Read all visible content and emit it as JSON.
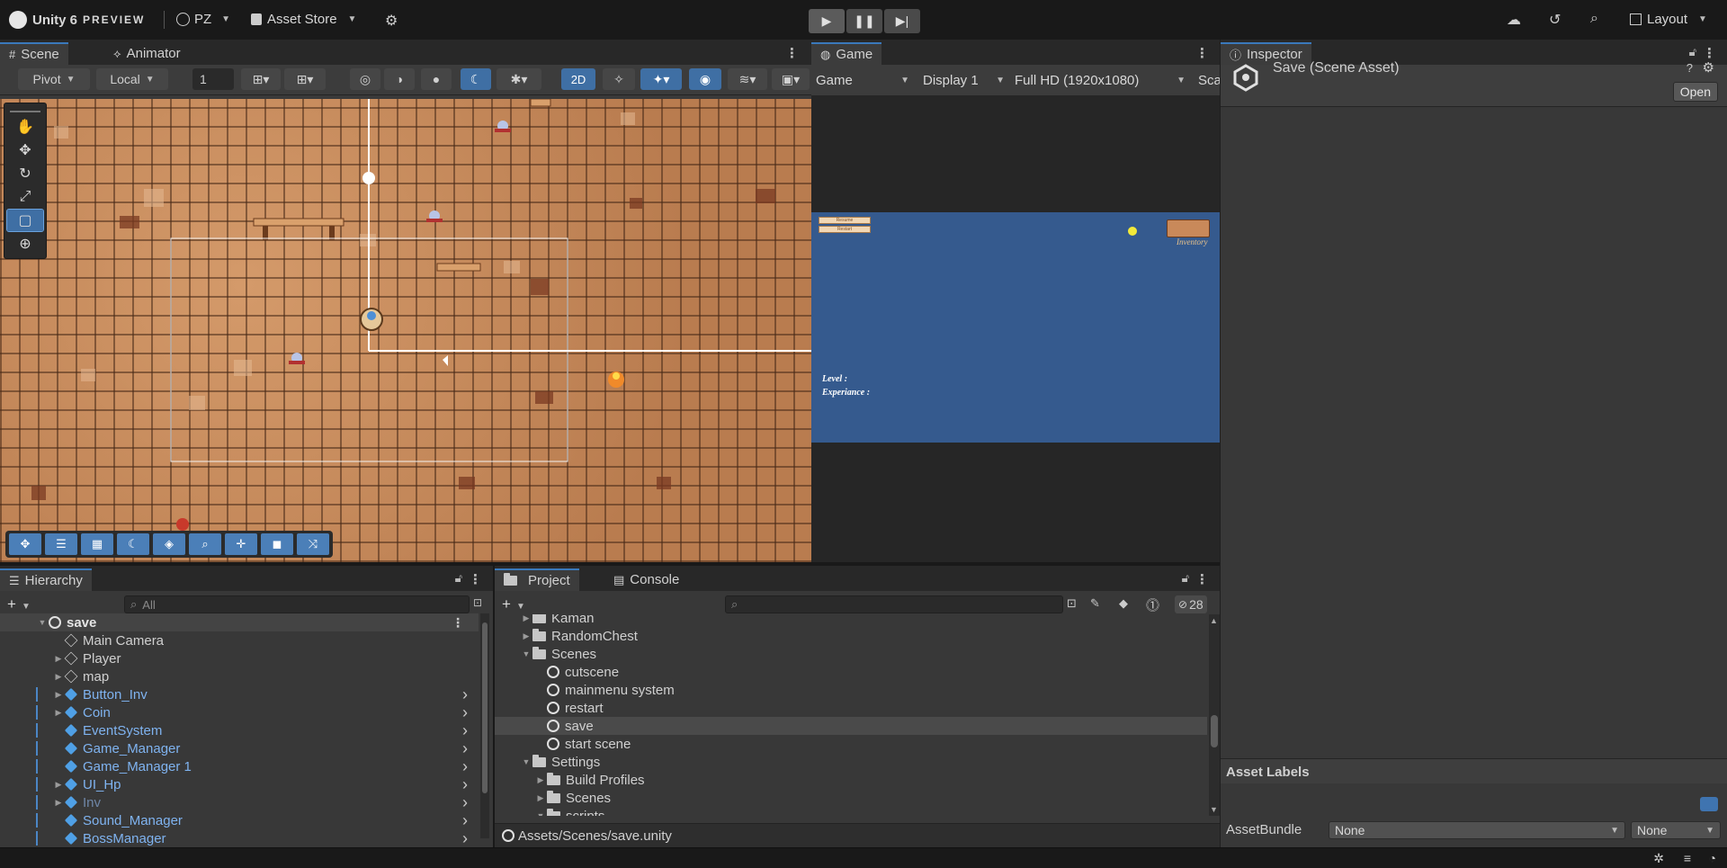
{
  "topbar": {
    "app_name": "Unity 6",
    "edition": "PREVIEW",
    "account": "PZ",
    "asset_store": "Asset Store",
    "layout": "Layout"
  },
  "scene": {
    "tabs": [
      "Scene",
      "Animator"
    ],
    "pivot": "Pivot",
    "local": "Local",
    "grid_snap_value": "1",
    "mode_2d": "2D"
  },
  "game": {
    "tab": "Game",
    "mode": "Game",
    "display": "Display 1",
    "resolution": "Full HD (1920x1080)",
    "scale_truncated": "Sca",
    "hud_button_1": "Resume",
    "hud_button_2": "Restart",
    "inventory_label": "Inventory",
    "level_label": "Level :",
    "experience_label": "Experiance :"
  },
  "inspector": {
    "tab": "Inspector",
    "asset_title": "Save (Scene Asset)",
    "open_button": "Open",
    "asset_labels": "Asset Labels",
    "asset_bundle_label": "AssetBundle",
    "asset_bundle_value": "None",
    "asset_variant_value": "None"
  },
  "hierarchy": {
    "tab": "Hierarchy",
    "search_placeholder": "All",
    "scene_name": "save",
    "items": [
      {
        "label": "Main Camera",
        "prefab": false,
        "expandable": false,
        "has_arrow": false,
        "dim": false
      },
      {
        "label": "Player",
        "prefab": false,
        "expandable": true,
        "has_arrow": false,
        "dim": false
      },
      {
        "label": "map",
        "prefab": false,
        "expandable": true,
        "has_arrow": false,
        "dim": false
      },
      {
        "label": "Button_Inv",
        "prefab": true,
        "expandable": true,
        "has_arrow": true,
        "dim": false
      },
      {
        "label": "Coin",
        "prefab": true,
        "expandable": true,
        "has_arrow": true,
        "dim": false
      },
      {
        "label": "EventSystem",
        "prefab": true,
        "expandable": false,
        "has_arrow": true,
        "dim": false
      },
      {
        "label": "Game_Manager",
        "prefab": true,
        "expandable": false,
        "has_arrow": true,
        "dim": false
      },
      {
        "label": "Game_Manager 1",
        "prefab": true,
        "expandable": false,
        "has_arrow": true,
        "dim": false
      },
      {
        "label": "UI_Hp",
        "prefab": true,
        "expandable": true,
        "has_arrow": true,
        "dim": false
      },
      {
        "label": "Inv",
        "prefab": true,
        "expandable": true,
        "has_arrow": true,
        "dim": true
      },
      {
        "label": "Sound_Manager",
        "prefab": true,
        "expandable": false,
        "has_arrow": true,
        "dim": false
      },
      {
        "label": "BossManager",
        "prefab": true,
        "expandable": false,
        "has_arrow": true,
        "dim": false
      }
    ]
  },
  "project": {
    "tabs": [
      "Project",
      "Console"
    ],
    "hidden_count": "28",
    "tree": [
      {
        "label": "Kaman",
        "type": "folder",
        "depth": 1,
        "expander": "right"
      },
      {
        "label": "RandomChest",
        "type": "folder",
        "depth": 1,
        "expander": "right"
      },
      {
        "label": "Scenes",
        "type": "folder-open",
        "depth": 1,
        "expander": "down"
      },
      {
        "label": "cutscene",
        "type": "scene",
        "depth": 2,
        "expander": ""
      },
      {
        "label": "mainmenu system",
        "type": "scene",
        "depth": 2,
        "expander": ""
      },
      {
        "label": "restart",
        "type": "scene",
        "depth": 2,
        "expander": ""
      },
      {
        "label": "save",
        "type": "scene",
        "depth": 2,
        "expander": "",
        "selected": true
      },
      {
        "label": "start scene",
        "type": "scene",
        "depth": 2,
        "expander": ""
      },
      {
        "label": "Settings",
        "type": "folder-open",
        "depth": 1,
        "expander": "down"
      },
      {
        "label": "Build Profiles",
        "type": "folder",
        "depth": 2,
        "expander": "right"
      },
      {
        "label": "Scenes",
        "type": "folder",
        "depth": 2,
        "expander": "right"
      },
      {
        "label": "scripts",
        "type": "folder-open",
        "depth": 2,
        "expander": "down"
      }
    ],
    "path": "Assets/Scenes/save.unity"
  },
  "colors": {
    "accent": "#3a79bb",
    "prefab_blue": "#7fb3f0",
    "game_bg": "#355a8e"
  }
}
